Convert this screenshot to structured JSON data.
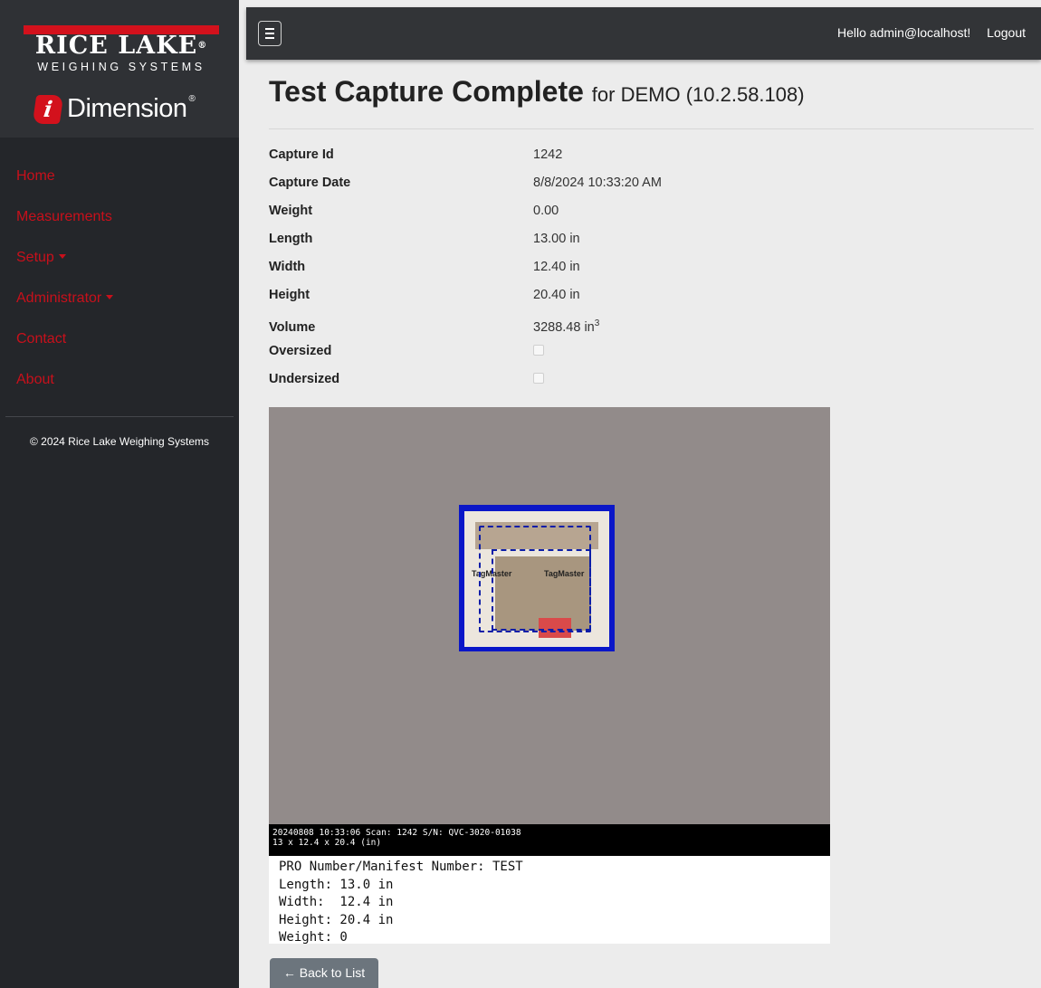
{
  "brand": {
    "company": "RICE LAKE",
    "tagline": "WEIGHING SYSTEMS",
    "product": "Dimension",
    "product_icon_letter": "i"
  },
  "nav": {
    "items": [
      {
        "label": "Home"
      },
      {
        "label": "Measurements"
      },
      {
        "label": "Setup",
        "dropdown": true
      },
      {
        "label": "Administrator",
        "dropdown": true
      },
      {
        "label": "Contact"
      },
      {
        "label": "About"
      }
    ]
  },
  "footer": {
    "copyright": "© 2024 Rice Lake Weighing Systems"
  },
  "topbar": {
    "greeting": "Hello admin@localhost!",
    "logout": "Logout"
  },
  "page": {
    "title": "Test Capture Complete",
    "subtitle": "for DEMO (10.2.58.108)"
  },
  "details": [
    {
      "key": "Capture Id",
      "value": "1242"
    },
    {
      "key": "Capture Date",
      "value": "8/8/2024 10:33:20 AM"
    },
    {
      "key": "Weight",
      "value": "0.00"
    },
    {
      "key": "Length",
      "value": "13.00 in"
    },
    {
      "key": "Width",
      "value": "12.40 in"
    },
    {
      "key": "Height",
      "value": "20.40 in"
    },
    {
      "key": "Volume",
      "value": "3288.48 in",
      "sup": "3"
    },
    {
      "key": "Oversized",
      "checked": false
    },
    {
      "key": "Undersized",
      "checked": false
    }
  ],
  "capture": {
    "overlay_line1": "20240808 10:33:06 Scan: 1242 S/N: QVC-3020-01038",
    "overlay_line2": "13 x 12.4 x 20.4 (in)",
    "box_label_left": "TagMaster",
    "box_label_right": "TagMaster"
  },
  "info": {
    "lines": [
      "PRO Number/Manifest Number: TEST",
      "Length: 13.0 in",
      "Width:  12.4 in",
      "Height: 20.4 in",
      "Weight: 0"
    ]
  },
  "back_button": {
    "label": "← Back to List"
  }
}
